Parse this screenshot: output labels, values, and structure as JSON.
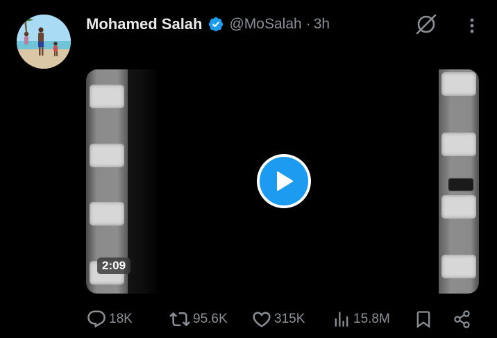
{
  "author": {
    "display_name": "Mohamed Salah",
    "handle": "@MoSalah",
    "separator": "·",
    "time": "3h",
    "verified": true,
    "verified_color": "#1d9bf0"
  },
  "header_icons": {
    "grok": "grok-icon",
    "more": "more-options-icon"
  },
  "media": {
    "type": "video",
    "duration": "2:09",
    "play_icon": "play-icon",
    "play_color": "#1d9bf0"
  },
  "actions": {
    "replies": {
      "icon": "reply-icon",
      "count": "18K"
    },
    "reposts": {
      "icon": "repost-icon",
      "count": "95.6K"
    },
    "likes": {
      "icon": "like-icon",
      "count": "315K"
    },
    "views": {
      "icon": "views-icon",
      "count": "15.8M"
    },
    "bookmark": {
      "icon": "bookmark-icon"
    },
    "share": {
      "icon": "share-icon"
    }
  },
  "colors": {
    "background": "#000000",
    "primary_text": "#e7e9ea",
    "secondary_text": "#8b9096",
    "accent": "#1d9bf0"
  }
}
